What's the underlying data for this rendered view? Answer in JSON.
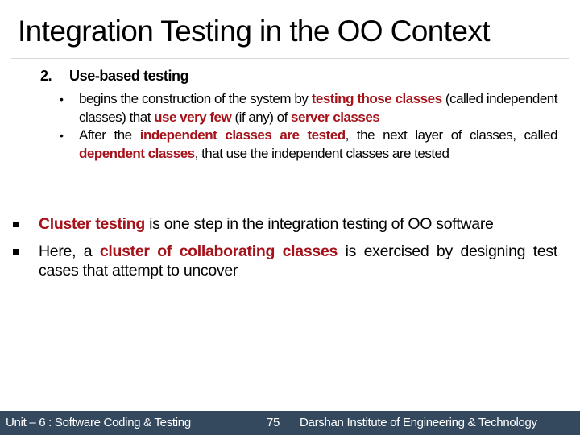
{
  "slide": {
    "title": "Integration Testing in the OO Context",
    "accent_color": "#a5121a",
    "footer_color": "#34495e"
  },
  "section": {
    "number": "2.",
    "heading": "Use-based testing",
    "bullet_icon": "round-bullet",
    "items": [
      {
        "segments": [
          {
            "text": "begins the construction of the system by ",
            "highlight": false
          },
          {
            "text": "testing those classes",
            "highlight": true
          },
          {
            "text": " (called independent classes) that ",
            "highlight": false
          },
          {
            "text": "use very few",
            "highlight": true
          },
          {
            "text": " (if any) of ",
            "highlight": false
          },
          {
            "text": "server classes",
            "highlight": true
          }
        ]
      },
      {
        "segments": [
          {
            "text": "After the ",
            "highlight": false
          },
          {
            "text": "independent classes are tested",
            "highlight": true
          },
          {
            "text": ", the next layer of classes, called ",
            "highlight": false
          },
          {
            "text": "dependent classes",
            "highlight": true
          },
          {
            "text": ", that use the independent classes are tested",
            "highlight": false
          }
        ]
      }
    ]
  },
  "main_bullets": {
    "bullet_icon": "square-bullet",
    "items": [
      {
        "segments": [
          {
            "text": "Cluster testing",
            "highlight": true
          },
          {
            "text": " is one step in the integration testing of OO software",
            "highlight": false
          }
        ]
      },
      {
        "segments": [
          {
            "text": "Here, a ",
            "highlight": false
          },
          {
            "text": "cluster of collaborating classes",
            "highlight": true
          },
          {
            "text": " is exercised by designing test cases that attempt to uncover",
            "highlight": false
          }
        ]
      }
    ]
  },
  "footer": {
    "unit": "Unit – 6 : Software Coding & Testing",
    "page_number": "75",
    "institute": "Darshan Institute of Engineering & Technology"
  }
}
